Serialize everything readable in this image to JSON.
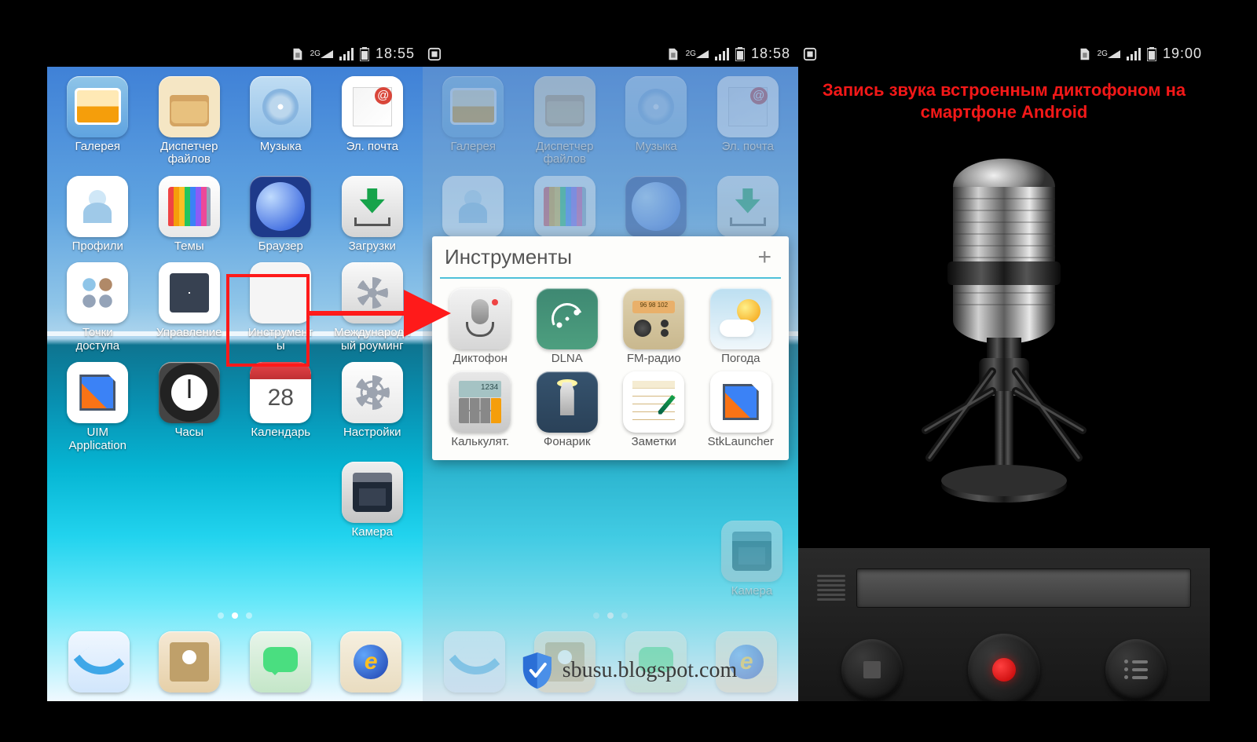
{
  "status": {
    "network": "2G",
    "screens": [
      {
        "time": "18:55"
      },
      {
        "time": "18:58"
      },
      {
        "time": "19:00"
      }
    ]
  },
  "screen1": {
    "apps": [
      {
        "id": "gallery",
        "label": "Галерея"
      },
      {
        "id": "files",
        "label": "Диспетчер\nфайлов"
      },
      {
        "id": "music",
        "label": "Музыка"
      },
      {
        "id": "mail",
        "label": "Эл. почта"
      },
      {
        "id": "profiles",
        "label": "Профили"
      },
      {
        "id": "themes",
        "label": "Темы"
      },
      {
        "id": "browser",
        "label": "Браузер"
      },
      {
        "id": "downloads",
        "label": "Загрузки"
      },
      {
        "id": "ap",
        "label": "Точки\nдоступа"
      },
      {
        "id": "manage",
        "label": "Управление"
      },
      {
        "id": "tools",
        "label": "Инструмент\nы"
      },
      {
        "id": "roaming",
        "label": "Международн\nый роуминг"
      },
      {
        "id": "uim",
        "label": "UIM\nApplication"
      },
      {
        "id": "clock",
        "label": "Часы"
      },
      {
        "id": "calendar",
        "label": "Календарь",
        "day": "28"
      },
      {
        "id": "settings",
        "label": "Настройки"
      },
      {
        "id": "camera",
        "label": "Камера"
      }
    ],
    "dock": [
      "phone",
      "contacts",
      "sms",
      "ebrowser"
    ]
  },
  "screen2": {
    "bg_apps_dim": [
      "Галерея",
      "Диспетчер\nфайлов",
      "Музыка",
      "Эл. почта",
      "Профили",
      "Темы",
      "Браузер",
      "Загрузки"
    ],
    "bg_row5_label": "Камера",
    "folder": {
      "title": "Инструменты",
      "apps": [
        {
          "id": "dictaphone",
          "label": "Диктофон"
        },
        {
          "id": "dlna",
          "label": "DLNA"
        },
        {
          "id": "radio",
          "label": "FM-радио",
          "freq": "96  98  102"
        },
        {
          "id": "weather",
          "label": "Погода"
        },
        {
          "id": "calc",
          "label": "Калькулят."
        },
        {
          "id": "torch",
          "label": "Фонарик"
        },
        {
          "id": "notes",
          "label": "Заметки"
        },
        {
          "id": "stk",
          "label": "StkLauncher"
        }
      ]
    }
  },
  "screen3": {
    "title": "Запись звука встроенным\nдиктофоном на смартфоне\nAndroid"
  },
  "watermark": "sbusu.blogspot.com"
}
